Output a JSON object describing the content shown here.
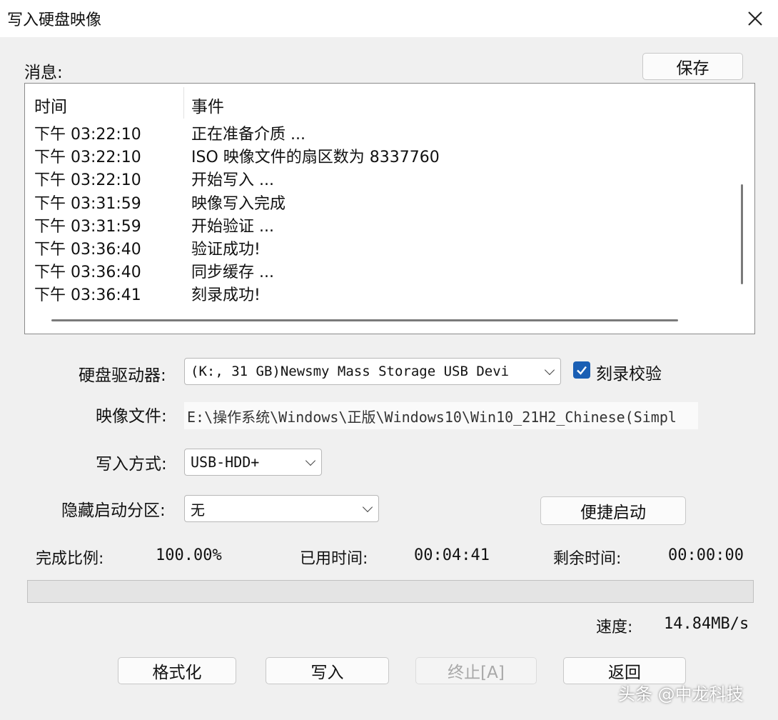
{
  "window": {
    "title": "写入硬盘映像",
    "close_icon": "close-icon"
  },
  "messages": {
    "label": "消息:",
    "save_label": "保存",
    "columns": [
      "时间",
      "事件"
    ],
    "rows": [
      {
        "time": "下午 03:22:10",
        "event": "正在准备介质 ..."
      },
      {
        "time": "下午 03:22:10",
        "event": "ISO 映像文件的扇区数为 8337760"
      },
      {
        "time": "下午 03:22:10",
        "event": "开始写入 ..."
      },
      {
        "time": "下午 03:31:59",
        "event": "映像写入完成"
      },
      {
        "time": "下午 03:31:59",
        "event": "开始验证 ..."
      },
      {
        "time": "下午 03:36:40",
        "event": "验证成功!"
      },
      {
        "time": "下午 03:36:40",
        "event": "同步缓存 ..."
      },
      {
        "time": "下午 03:36:41",
        "event": "刻录成功!"
      }
    ]
  },
  "form": {
    "drive_label": "硬盘驱动器:",
    "drive_value": "(K:, 31 GB)Newsmy Mass Storage USB Devi",
    "verify_label": "刻录校验",
    "verify_checked": true,
    "image_label": "映像文件:",
    "image_value": "E:\\操作系统\\Windows\\正版\\Windows10\\Win10_21H2_Chinese(Simpl",
    "write_mode_label": "写入方式:",
    "write_mode_value": "USB-HDD+",
    "hidden_partition_label": "隐藏启动分区:",
    "hidden_partition_value": "无",
    "quick_boot_label": "便捷启动"
  },
  "status": {
    "completion_label": "完成比例:",
    "completion_value": "100.00%",
    "elapsed_label": "已用时间:",
    "elapsed_value": "00:04:41",
    "remaining_label": "剩余时间:",
    "remaining_value": "00:00:00",
    "progress_fraction": 1.0,
    "speed_label": "速度:",
    "speed_value": "14.84MB/s"
  },
  "buttons": {
    "format": "格式化",
    "write": "写入",
    "abort": "终止[A]",
    "back": "返回"
  },
  "watermark": "头条 @中龙科技",
  "colors": {
    "checkbox_accent": "#1a5fb4",
    "window_bg": "#f0f0f0"
  }
}
